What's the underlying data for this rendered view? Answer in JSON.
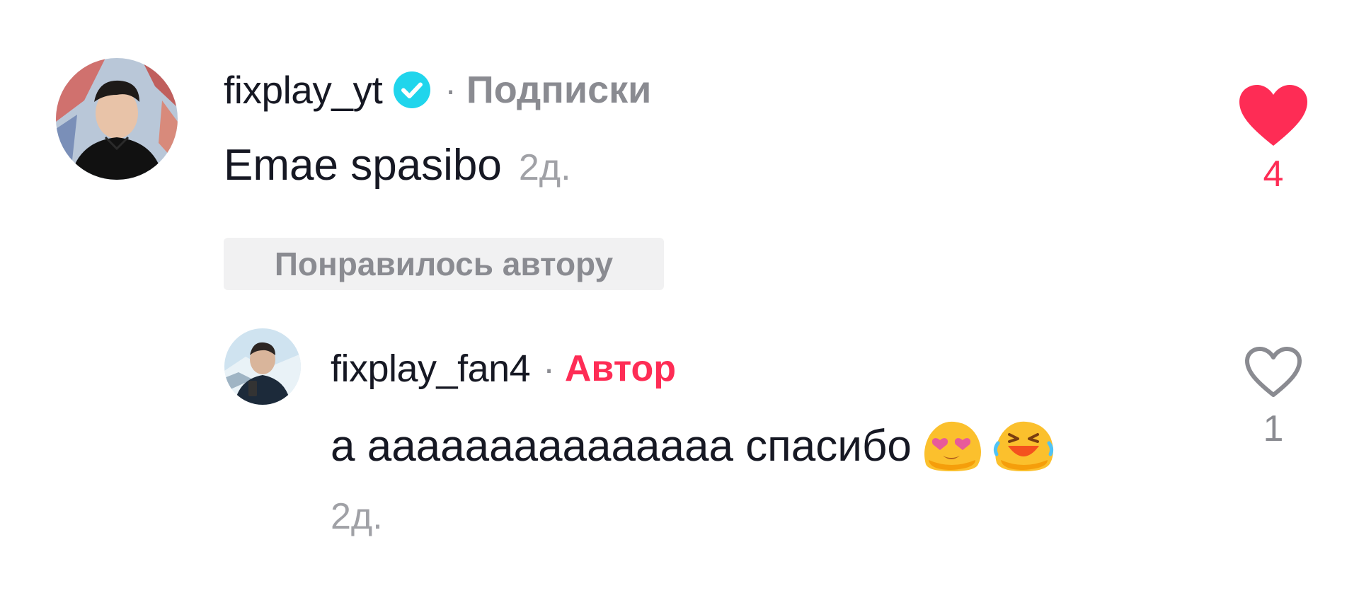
{
  "comment": {
    "username": "fixplay_yt",
    "verified": true,
    "relation": "Подписки",
    "text": "Emae spasibo",
    "time": "2д.",
    "liked_by_author_label": "Понравилось автору",
    "likes": "4",
    "liked": true
  },
  "reply": {
    "username": "fixplay_fan4",
    "role": "Автор",
    "text": "а ааааааааааааааа спасибо",
    "emojis": [
      "heart-eyes-emoji",
      "laughing-crying-emoji"
    ],
    "time": "2д.",
    "likes": "1",
    "liked": false
  },
  "separator": "·",
  "colors": {
    "accent": "#fe2c55",
    "verified": "#20d5ec",
    "muted": "#8a8b91",
    "text": "#161823"
  }
}
